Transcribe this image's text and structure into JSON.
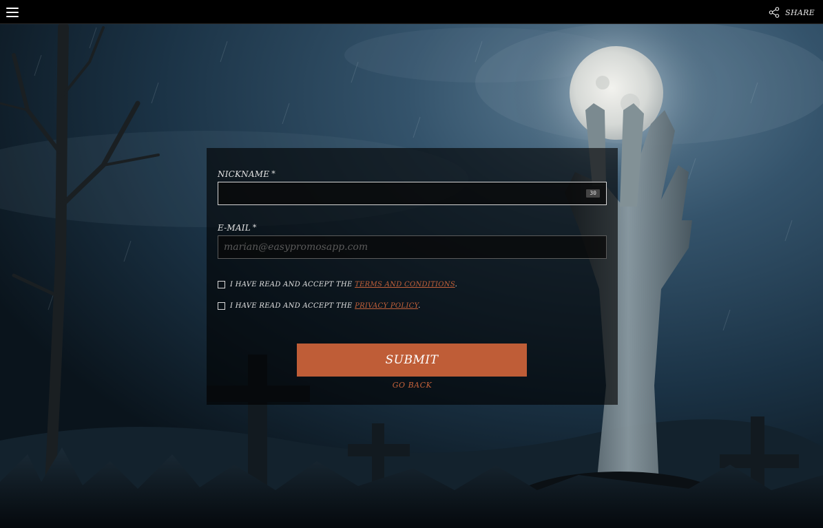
{
  "topbar": {
    "menu_icon": "hamburger-menu-icon",
    "share_icon": "share-icon",
    "share_label": "SHARE"
  },
  "form": {
    "nickname": {
      "label": "NICKNAME",
      "required_mark": "*",
      "value": "",
      "counter": "30"
    },
    "email": {
      "label": "E-MAIL",
      "required_mark": "*",
      "value": "",
      "placeholder": "marian@easypromosapp.com"
    },
    "terms": {
      "text": "I HAVE READ AND ACCEPT THE",
      "link": "TERMS AND CONDITIONS",
      "suffix": ".",
      "checked": false
    },
    "privacy": {
      "text": "I HAVE READ AND ACCEPT THE",
      "link": "PRIVACY POLICY",
      "suffix": ".",
      "checked": false
    },
    "submit_label": "SUBMIT",
    "go_back_label": "GO BACK"
  },
  "colors": {
    "accent": "#bf5d37",
    "link": "#c4613a",
    "topbar": "#000000"
  }
}
